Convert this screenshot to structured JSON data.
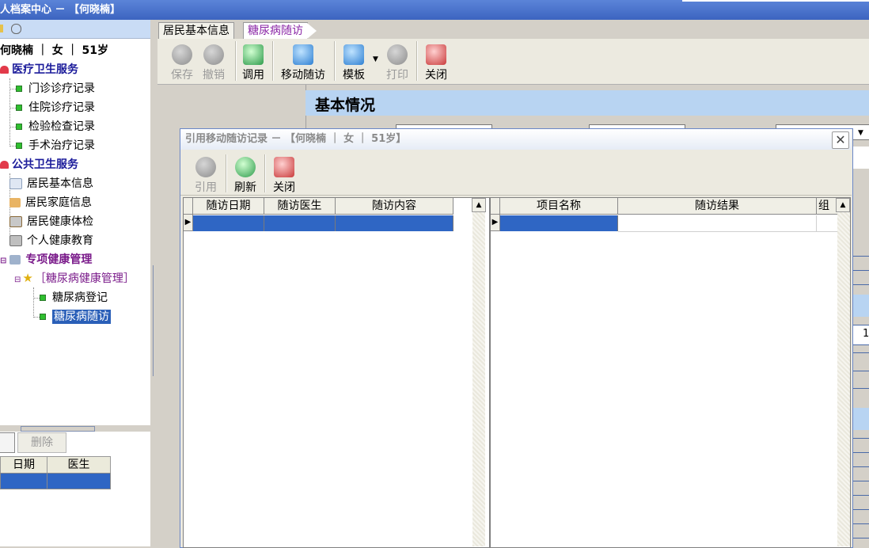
{
  "window": {
    "title": "人档案中心 － 【何晓楠】"
  },
  "left": {
    "patient_header": "何晓楠 ｜ 女 ｜ 51岁",
    "categories": {
      "medical": "医疗卫生服务",
      "public": "公共卫生服务",
      "special": "专项健康管理"
    },
    "medical_items": [
      "门诊诊疗记录",
      "住院诊疗记录",
      "检验检查记录",
      "手术治疗记录"
    ],
    "public_items": [
      "居民基本信息",
      "居民家庭信息",
      "居民健康体检",
      "个人健康教育"
    ],
    "special_group": "［糖尿病健康管理］",
    "special_items": [
      "糖尿病登记",
      "糖尿病随访"
    ],
    "delete_label": "删除",
    "grid_headers": [
      "日期",
      "医生"
    ]
  },
  "tabs": [
    "居民基本信息",
    "糖尿病随访"
  ],
  "toolbar": {
    "save": "保存",
    "undo": "撤销",
    "call": "调用",
    "mobile": "移动随访",
    "template": "模板",
    "print": "打印",
    "close": "关闭"
  },
  "section": {
    "title": "基本情况"
  },
  "background_value": "1",
  "dialog": {
    "title": "引用移动随访记录 － 【何晓楠 ｜ 女 ｜ 51岁】",
    "toolbar": {
      "quote": "引用",
      "refresh": "刷新",
      "close": "关闭"
    },
    "left_headers": [
      "随访日期",
      "随访医生",
      "随访内容"
    ],
    "right_headers": [
      "项目名称",
      "随访结果",
      "组别"
    ]
  }
}
